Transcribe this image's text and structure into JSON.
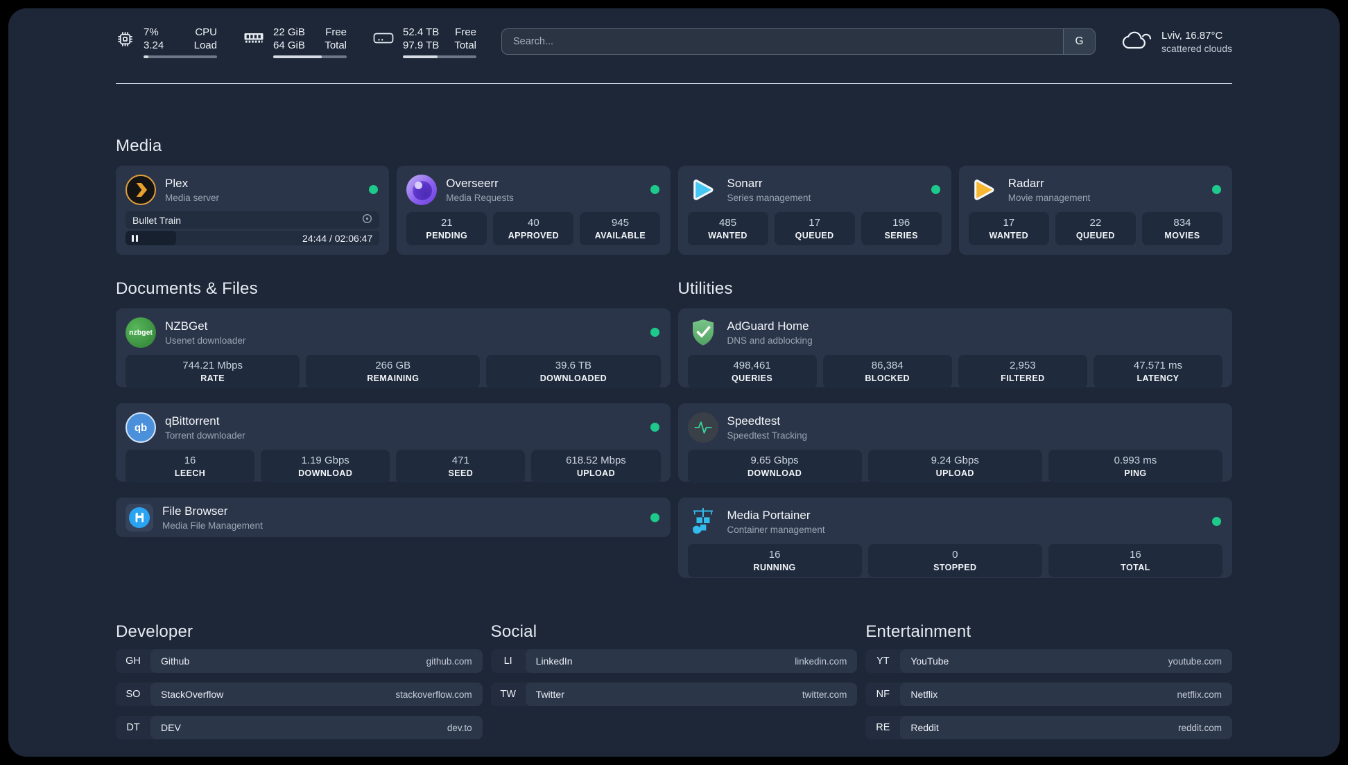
{
  "system": {
    "cpu": {
      "v1": "7%",
      "l1": "CPU",
      "v2": "3.24",
      "l2": "Load",
      "pct": 7
    },
    "ram": {
      "v1": "22 GiB",
      "l1": "Free",
      "v2": "64 GiB",
      "l2": "Total",
      "pct": 66
    },
    "disk": {
      "v1": "52.4 TB",
      "l1": "Free",
      "v2": "97.9 TB",
      "l2": "Total",
      "pct": 47
    }
  },
  "search": {
    "placeholder": "Search...",
    "engine_button": "G"
  },
  "weather": {
    "line1": "Lviv, 16.87°C",
    "line2": "scattered clouds"
  },
  "colors": {
    "status_online": "#1ec98c",
    "surface": "#1d2737",
    "card": "#2b3549"
  },
  "sections": {
    "media": "Media",
    "documents": "Documents & Files",
    "utilities": "Utilities",
    "developer": "Developer",
    "social": "Social",
    "entertainment": "Entertainment"
  },
  "apps": {
    "plex": {
      "title": "Plex",
      "subtitle": "Media server",
      "player": {
        "track": "Bullet Train",
        "time": "24:44 / 02:06:47",
        "pct": 20
      }
    },
    "overseerr": {
      "title": "Overseerr",
      "subtitle": "Media Requests",
      "stats": [
        {
          "value": "21",
          "label": "PENDING"
        },
        {
          "value": "40",
          "label": "APPROVED"
        },
        {
          "value": "945",
          "label": "AVAILABLE"
        }
      ]
    },
    "sonarr": {
      "title": "Sonarr",
      "subtitle": "Series management",
      "stats": [
        {
          "value": "485",
          "label": "WANTED"
        },
        {
          "value": "17",
          "label": "QUEUED"
        },
        {
          "value": "196",
          "label": "SERIES"
        }
      ]
    },
    "radarr": {
      "title": "Radarr",
      "subtitle": "Movie management",
      "stats": [
        {
          "value": "17",
          "label": "WANTED"
        },
        {
          "value": "22",
          "label": "QUEUED"
        },
        {
          "value": "834",
          "label": "MOVIES"
        }
      ]
    },
    "nzbget": {
      "title": "NZBGet",
      "subtitle": "Usenet downloader",
      "icon_label": "nzbget",
      "stats": [
        {
          "value": "744.21 Mbps",
          "label": "RATE"
        },
        {
          "value": "266 GB",
          "label": "REMAINING"
        },
        {
          "value": "39.6 TB",
          "label": "DOWNLOADED"
        }
      ]
    },
    "adguard": {
      "title": "AdGuard Home",
      "subtitle": "DNS and adblocking",
      "stats": [
        {
          "value": "498,461",
          "label": "QUERIES"
        },
        {
          "value": "86,384",
          "label": "BLOCKED"
        },
        {
          "value": "2,953",
          "label": "FILTERED"
        },
        {
          "value": "47.571 ms",
          "label": "LATENCY"
        }
      ]
    },
    "qbittorrent": {
      "title": "qBittorrent",
      "subtitle": "Torrent downloader",
      "icon_label": "qb",
      "stats": [
        {
          "value": "16",
          "label": "LEECH"
        },
        {
          "value": "1.19 Gbps",
          "label": "DOWNLOAD"
        },
        {
          "value": "471",
          "label": "SEED"
        },
        {
          "value": "618.52 Mbps",
          "label": "UPLOAD"
        }
      ]
    },
    "speedtest": {
      "title": "Speedtest",
      "subtitle": "Speedtest Tracking",
      "stats": [
        {
          "value": "9.65 Gbps",
          "label": "DOWNLOAD"
        },
        {
          "value": "9.24 Gbps",
          "label": "UPLOAD"
        },
        {
          "value": "0.993 ms",
          "label": "PING"
        }
      ]
    },
    "filebrowser": {
      "title": "File Browser",
      "subtitle": "Media File Management"
    },
    "portainer": {
      "title": "Media Portainer",
      "subtitle": "Container management",
      "stats": [
        {
          "value": "16",
          "label": "RUNNING"
        },
        {
          "value": "0",
          "label": "STOPPED"
        },
        {
          "value": "16",
          "label": "TOTAL"
        }
      ]
    }
  },
  "links": {
    "developer": [
      {
        "abbr": "GH",
        "name": "Github",
        "url": "github.com"
      },
      {
        "abbr": "SO",
        "name": "StackOverflow",
        "url": "stackoverflow.com"
      },
      {
        "abbr": "DT",
        "name": "DEV",
        "url": "dev.to"
      }
    ],
    "social": [
      {
        "abbr": "LI",
        "name": "LinkedIn",
        "url": "linkedin.com"
      },
      {
        "abbr": "TW",
        "name": "Twitter",
        "url": "twitter.com"
      }
    ],
    "entertainment": [
      {
        "abbr": "YT",
        "name": "YouTube",
        "url": "youtube.com"
      },
      {
        "abbr": "NF",
        "name": "Netflix",
        "url": "netflix.com"
      },
      {
        "abbr": "RE",
        "name": "Reddit",
        "url": "reddit.com"
      }
    ]
  }
}
